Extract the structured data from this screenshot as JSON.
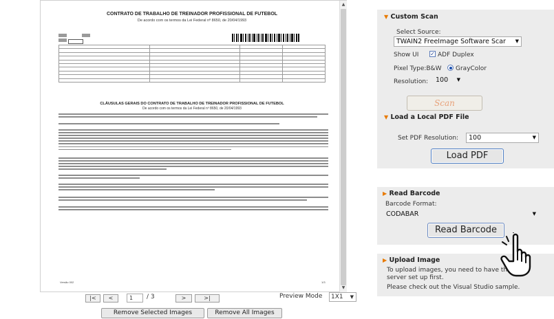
{
  "viewer": {
    "document": {
      "title": "CONTRATO DE TRABALHO DE TREINADOR PROFISSIONAL DE FUTEBOL",
      "subtitle": "De acordo com os termos da Lei Federal nº 8650, de 20/04/1993",
      "section_title": "CLÁUSULAS GERAIS DO CONTRATO DE TRABALHO DE TREINADOR PROFISSIONAL DE FUTEBOL",
      "section_subtitle": "De acordo com os termos da Lei Federal nº 8650, de 20/04/1993",
      "footer_left": "Versão 002",
      "footer_right": "1/3"
    },
    "nav": {
      "first": "|<",
      "prev": "<",
      "current_page": "1",
      "total_pages": "/ 3",
      "next": ">",
      "last": ">|",
      "preview_mode_label": "Preview Mode",
      "preview_mode_value": "1X1"
    },
    "buttons": {
      "remove_selected": "Remove Selected Images",
      "remove_all": "Remove All Images"
    }
  },
  "panel": {
    "custom_scan": {
      "title": "Custom Scan",
      "select_source_label": "Select Source:",
      "source_value": "TWAIN2 FreeImage Software Scar",
      "show_ui_label": "Show UI",
      "adf_label": "ADF Duplex",
      "adf_checked": true,
      "pixel_type_label": "Pixel Type:B&W",
      "graycolor_label": "GrayColor",
      "graycolor_selected": true,
      "resolution_label": "Resolution:",
      "resolution_value": "100",
      "scan_button": "Scan"
    },
    "local_pdf": {
      "title": "Load a Local PDF File",
      "resolution_label": "Set PDF Resolution:",
      "resolution_value": "100",
      "load_button": "Load PDF"
    },
    "barcode": {
      "title": "Read Barcode",
      "format_label": "Barcode Format:",
      "format_value": "CODABAR",
      "read_button": "Read Barcode"
    },
    "upload": {
      "title": "Upload Image",
      "line1": "To upload images, you need to have the web",
      "line2": "server set up first.",
      "line3": "Please check out the Visual Studio sample."
    }
  },
  "icons": {
    "collapse": "triangle-down-icon",
    "expand": "triangle-right-icon",
    "dropdown": "chevron-down-icon",
    "cursor": "hand-pointer-icon"
  },
  "colors": {
    "panel_bg": "#ececec",
    "accent_orange": "#e87a00",
    "button_border_blue": "#4f7fc4",
    "scan_text": "#e8a27a"
  }
}
